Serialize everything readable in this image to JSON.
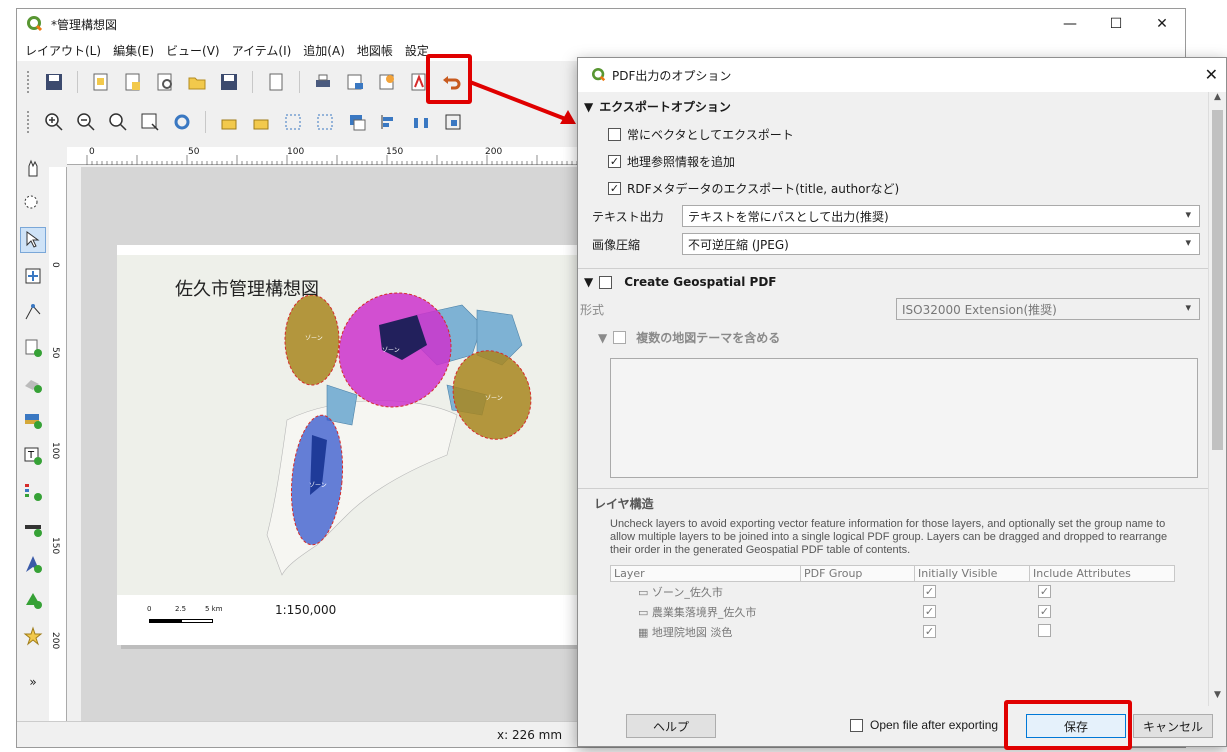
{
  "main_window": {
    "title": "*管理構想図",
    "menu": [
      "レイアウト(L)",
      "編集(E)",
      "ビュー(V)",
      "アイテム(I)",
      "追加(A)",
      "地図帳",
      "設定"
    ],
    "ruler_labels": [
      "0",
      "50",
      "100",
      "150",
      "200"
    ],
    "ruler_left_labels": [
      "0",
      "50",
      "100",
      "150",
      "200"
    ],
    "coord": "x: 226 mm"
  },
  "map": {
    "title": "佐久市管理構想図",
    "scale": "1:150,000",
    "scalebar": [
      "0",
      "2.5",
      "5 km"
    ],
    "zone_label": "ゾーン"
  },
  "dialog": {
    "title": "PDF出力のオプション",
    "export_options": {
      "header": "エクスポートオプション",
      "always_vector": {
        "label": "常にベクタとしてエクスポート",
        "checked": false
      },
      "georef": {
        "label": "地理参照情報を追加",
        "checked": true
      },
      "rdf": {
        "label": "RDFメタデータのエクスポート(title, authorなど)",
        "checked": true
      },
      "text_export_label": "テキスト出力",
      "text_export_value": "テキストを常にパスとして出力(推奨)",
      "image_compress_label": "画像圧縮",
      "image_compress_value": "不可逆圧縮 (JPEG)"
    },
    "geospatial": {
      "header": "Create Geospatial PDF",
      "format_label": "形式",
      "format_value": "ISO32000 Extension(推奨)",
      "themes_label": "複数の地図テーマを含める"
    },
    "layer_structure": {
      "header": "レイヤ構造",
      "description": "Uncheck layers to avoid exporting vector feature information for those layers, and optionally set the group name to allow multiple layers to be joined into a single logical PDF group. Layers can be dragged and dropped to rearrange their order in the generated Geospatial PDF table of contents.",
      "columns": [
        "Layer",
        "PDF Group",
        "Initially Visible",
        "Include Attributes"
      ],
      "rows": [
        {
          "name": "ゾーン_佐久市",
          "group": "",
          "visible": "✓",
          "attrs": "✓"
        },
        {
          "name": "農業集落境界_佐久市",
          "group": "",
          "visible": "✓",
          "attrs": "✓"
        },
        {
          "name": "地理院地図 淡色",
          "group": "",
          "visible": "✓",
          "attrs": ""
        }
      ]
    },
    "footer": {
      "help": "ヘルプ",
      "open_after": "Open file after exporting",
      "save": "保存",
      "cancel": "キャンセル"
    }
  },
  "colors": {
    "highlight": "#e00000",
    "zone_yellow": "#a8861f",
    "zone_magenta": "#cc33cc",
    "zone_blue": "#3355cc"
  }
}
